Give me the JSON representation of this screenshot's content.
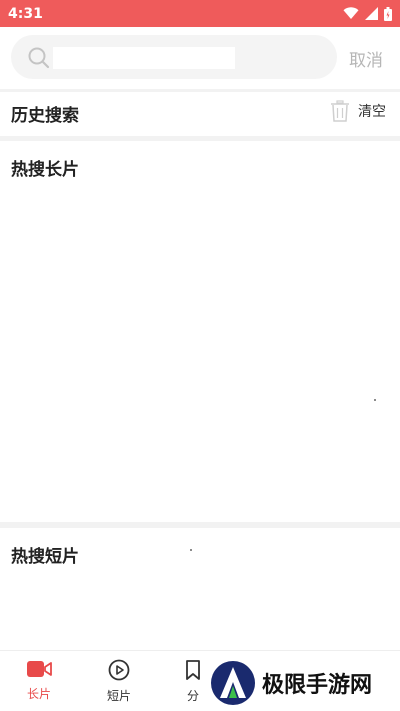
{
  "status_bar": {
    "time": "4:31"
  },
  "search": {
    "value": "",
    "cancel_label": "取消"
  },
  "history": {
    "title": "历史搜索",
    "clear_label": "清空"
  },
  "hot_long": {
    "title": "热搜长片"
  },
  "hot_short": {
    "title": "热搜短片"
  },
  "tabs": [
    {
      "label": "长片",
      "icon": "video-camera-icon",
      "active": true
    },
    {
      "label": "短片",
      "icon": "play-circle-icon",
      "active": false
    },
    {
      "label": "分",
      "icon": "bookmark-icon",
      "active": false
    }
  ],
  "watermark": {
    "text": "极限手游网"
  },
  "colors": {
    "status_bar": "#ef5b5b",
    "accent": "#e84a4a"
  }
}
